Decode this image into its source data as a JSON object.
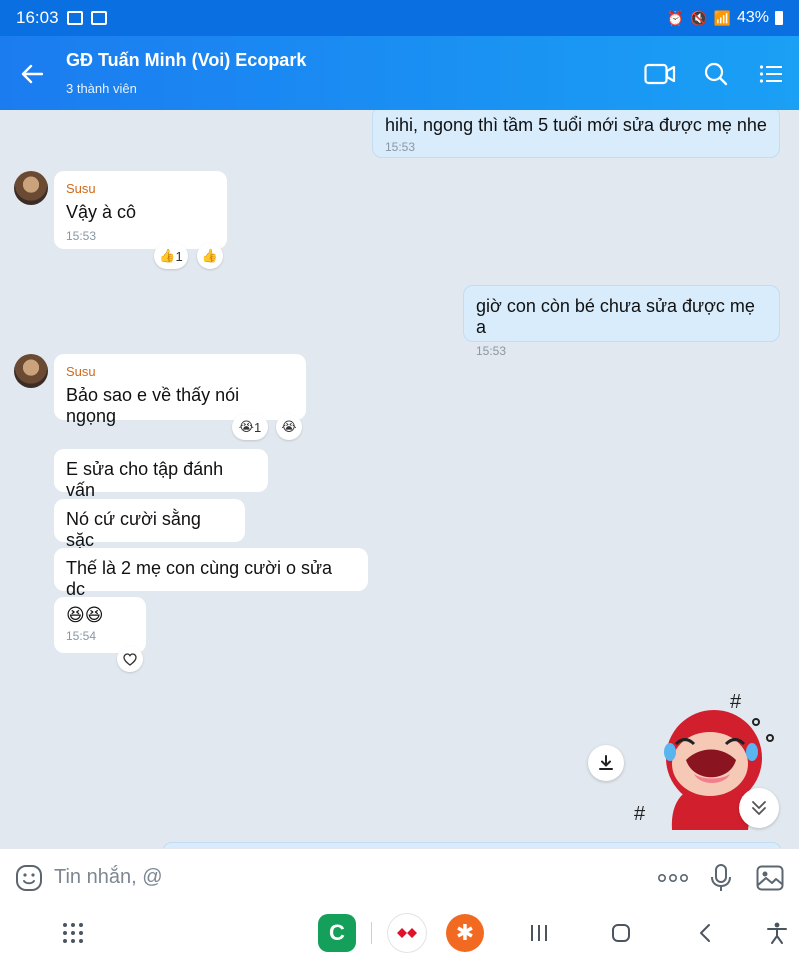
{
  "status_bar": {
    "time": "16:03",
    "battery": "43%"
  },
  "header": {
    "title": "GĐ Tuấn Minh (Voi) Ecopark",
    "subtitle": "3 thành viên"
  },
  "messages": {
    "m0": {
      "text": "hihi, ngong thì tầm 5 tuổi mới sửa được mẹ nhe",
      "time": "15:53"
    },
    "m1": {
      "sender": "Susu",
      "text": "Vậy à cô",
      "time": "15:53",
      "reaction_count": "1"
    },
    "m2": {
      "text": "giờ con còn bé chưa sửa được mẹ a",
      "time": "15:53"
    },
    "m3": {
      "sender": "Susu",
      "text": "Bảo sao e về thấy nói ngọng",
      "reaction_count": "1"
    },
    "m4": {
      "text": "E sửa cho tập đánh vấn"
    },
    "m5": {
      "text": "Nó cứ cười sằng sặc"
    },
    "m6": {
      "text": "Thế là 2 mẹ con cùng cười o sửa dc"
    },
    "m7": {
      "text": "😆😆",
      "time": "15:54"
    }
  },
  "composer": {
    "placeholder": "Tin nhắn, @"
  },
  "colors": {
    "accent": "#1b7cf0",
    "sender": "#d0691c"
  }
}
